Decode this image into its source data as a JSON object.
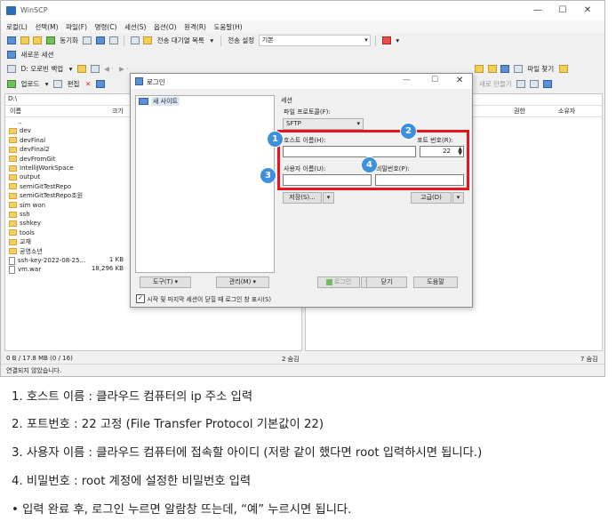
{
  "window": {
    "title": "WinSCP",
    "controls": {
      "minimize": "—",
      "maximize": "☐",
      "close": "✕"
    }
  },
  "menu": [
    "로컬(L)",
    "선택(M)",
    "파일(F)",
    "명령(C)",
    "세션(S)",
    "옵션(O)",
    "원격(R)",
    "도움말(H)"
  ],
  "toolbar1": {
    "sync_label": "동기화",
    "queue_label": "전송 대기열 목록",
    "transfer_settings_label": "전송 설정",
    "transfer_default": "기본"
  },
  "toolbar2": {
    "new_session_label": "새로운 세션"
  },
  "local_toolbar": {
    "drive": "D: 오로빈 백업",
    "upload_label": "업로드",
    "edit_label": "편집"
  },
  "remote_toolbar": {
    "find_files_label": "파일 찾기"
  },
  "local_pane": {
    "path": "D:\\",
    "columns": {
      "name": "이름",
      "size": "크기"
    },
    "files": [
      {
        "name": "..",
        "size": "",
        "type": "up"
      },
      {
        "name": "dev",
        "size": "",
        "type": "folder"
      },
      {
        "name": "devFinal",
        "size": "",
        "type": "folder"
      },
      {
        "name": "devFinal2",
        "size": "",
        "type": "folder"
      },
      {
        "name": "devFromGit",
        "size": "",
        "type": "folder"
      },
      {
        "name": "IntelliJWorkSpace",
        "size": "",
        "type": "folder"
      },
      {
        "name": "output",
        "size": "",
        "type": "folder"
      },
      {
        "name": "semiGitTestRepo",
        "size": "",
        "type": "folder"
      },
      {
        "name": "semiGitTestRepo조원",
        "size": "",
        "type": "folder"
      },
      {
        "name": "sim won",
        "size": "",
        "type": "folder"
      },
      {
        "name": "ssh",
        "size": "",
        "type": "folder"
      },
      {
        "name": "sshkey",
        "size": "",
        "type": "folder"
      },
      {
        "name": "tools",
        "size": "",
        "type": "folder"
      },
      {
        "name": "교재",
        "size": "",
        "type": "folder"
      },
      {
        "name": "공영소년",
        "size": "",
        "type": "folder"
      },
      {
        "name": "ssh-key-2022-08-25...",
        "size": "1 KB",
        "type": "file"
      },
      {
        "name": "vm.war",
        "size": "18,296 KB",
        "type": "file"
      }
    ],
    "status": "0 B / 17.8 MB (0 / 16)",
    "hidden": "2 숨김"
  },
  "remote_pane": {
    "columns": {
      "rights": "권한",
      "owner": "소유자"
    },
    "hidden": "7 숨김",
    "props_label": "속성",
    "new_label": "새로 만들기"
  },
  "statusbar": {
    "text": "연결되지 않았습니다."
  },
  "dialog": {
    "title": "로그인",
    "new_site": "새 사이트",
    "session_group": "세션",
    "protocol_label": "파일 프로토콜(F):",
    "protocol_value": "SFTP",
    "host_label": "호스트 이름(H):",
    "host_value": "",
    "port_label": "포트 번호(R):",
    "port_value": "22",
    "user_label": "사용자 이름(U):",
    "user_value": "",
    "password_label": "비밀번호(P):",
    "password_value": "",
    "save_label": "저장(S)...",
    "advanced_label": "고급(D)",
    "tools_label": "도구(T)",
    "manage_label": "관리(M)",
    "login_label": "로그인",
    "close_label": "닫기",
    "help_label": "도움말",
    "show_on_startup": "시작 및 마지막 세션이 닫힐 때 로그인 창 표시(S)"
  },
  "badges": [
    "1",
    "2",
    "3",
    "4"
  ],
  "notes": [
    "1.  호스트 이름 : 클라우드 컴퓨터의 ip 주소 입력",
    "2.  포트번호 : 22 고정 (File Transfer Protocol 기본값이 22)",
    "3.  사용자 이름 : 클라우드 컴퓨터에 접속할 아이디 (저랑 같이 했다면 root 입력하시면 됩니다.)",
    "4.  비밀번호 : root 계정에 설정한 비밀번호 입력",
    "•  입력 완료 후, 로그인 누르면 알람창 뜨는데, “예” 누르시면 됩니다."
  ],
  "colors": {
    "highlight": "#e8141c",
    "badge": "#3d8fe0",
    "folder": "#f5cf5f"
  }
}
